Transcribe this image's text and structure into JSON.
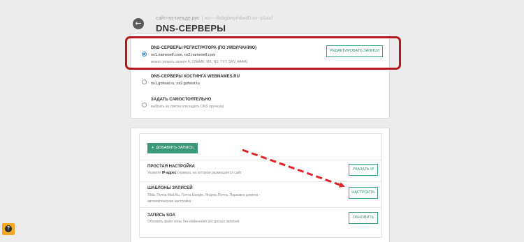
{
  "header": {
    "back_icon": "arrow-left-icon",
    "breadcrumb_site": "сайт-на-тильде.рус",
    "breadcrumb_separator": "|",
    "breadcrumb_sub": "xn----8sbgbwyrhbxd0.xn--p1acf",
    "title": "DNS-СЕРВЕРЫ"
  },
  "dns_options": [
    {
      "title": "DNS-СЕРВЕРЫ РЕГИСТРАТОРА (ПО УМОЛЧАНИЮ)",
      "servers": "ns1.nameself.com, ns2.nameself.com",
      "hint": "можно указать записи A, CNAME, MX, NS, TXT, SRV, AAAA)",
      "selected": true,
      "button": "РЕДАКТИРОВАТЬ ЗАПИСИ"
    },
    {
      "title": "DNS-СЕРВЕРЫ ХОСТИНГА WEBNAMES.RU",
      "servers": "ns1.gohost.ru, ns2.gohost.ru",
      "selected": false
    },
    {
      "title": "ЗАДАТЬ САМОСТОЯТЕЛЬНО",
      "hint": "выбрать из списка или задать DNS вручную)",
      "selected": false
    }
  ],
  "records": {
    "add_button": "ДОБАВИТЬ ЗАПИСЬ",
    "add_icon": "plus-icon",
    "rows": [
      {
        "title": "ПРОСТАЯ НАСТРОЙКА",
        "desc_prefix": "Укажите ",
        "desc_bold": "IP-адрес",
        "desc_suffix": " сервера, на котором размещается сайт",
        "button": "УКАЗАТЬ IP"
      },
      {
        "title": "ШАБЛОНЫ ЗАПИСЕЙ",
        "desc_line1": "Tilda, Почта Mail.Ru, Почта Google, Яндекс.Почта, Парковка домена -",
        "desc_line2": "автоматическая настройка",
        "button": "НАСТРОИТЬ"
      },
      {
        "title": "ЗАПИСЬ SOA",
        "desc": "Обновить файл зоны без изменения ресурсных записей",
        "button": "ОБНОВИТЬ"
      }
    ]
  },
  "colors": {
    "accent_green": "#3a9a78",
    "highlight_red": "#b5161d",
    "arrow_red": "#e0262b",
    "radio_blue": "#2c8be0",
    "help_orange": "#f5a623"
  },
  "help_icon": "question-icon"
}
